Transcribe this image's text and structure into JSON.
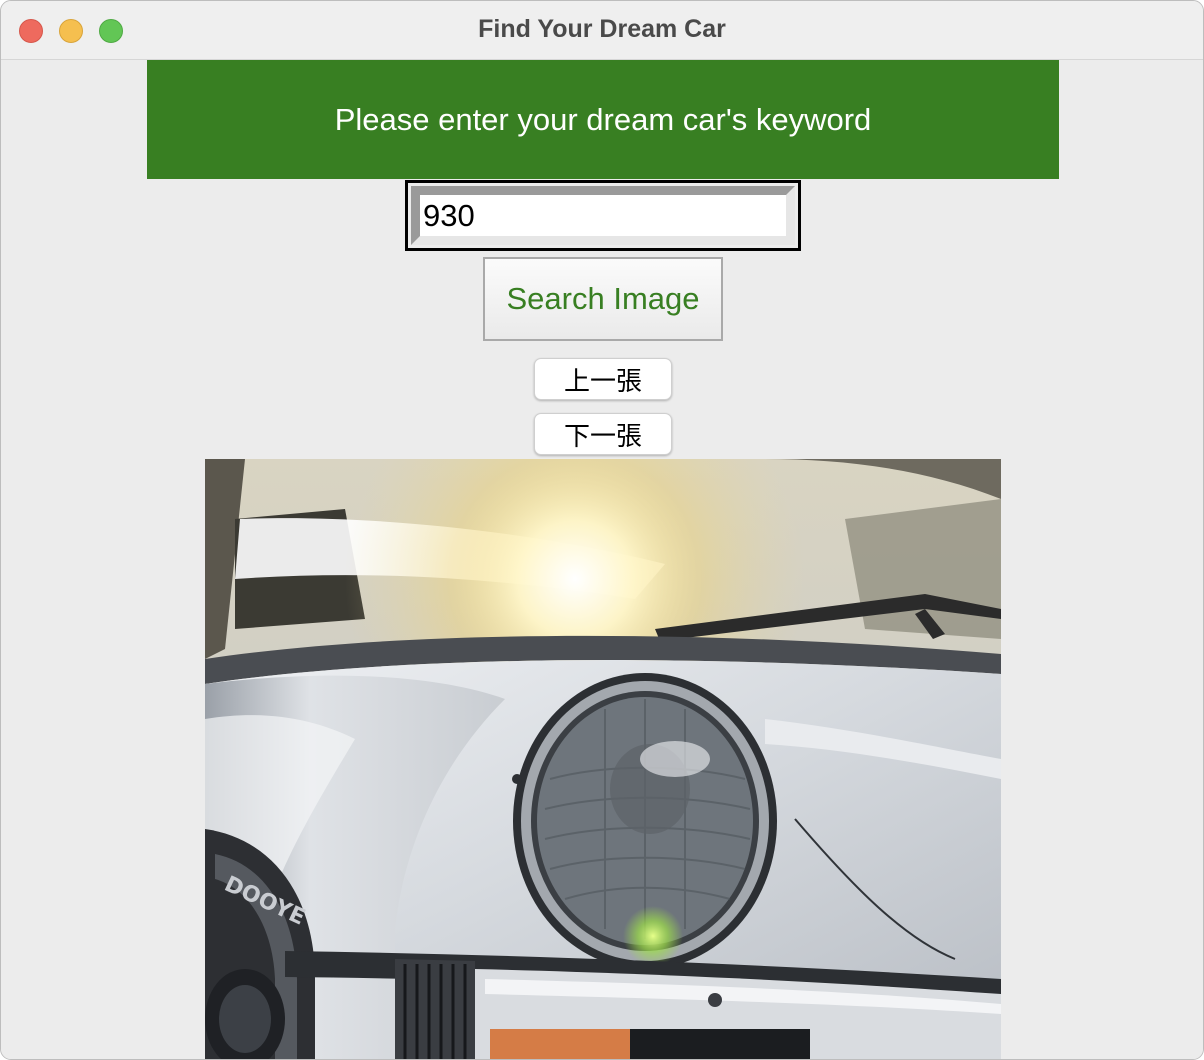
{
  "window": {
    "title": "Find Your Dream Car"
  },
  "banner": {
    "text": "Please enter your dream car's keyword"
  },
  "search": {
    "value": "930",
    "button_label": "Search Image"
  },
  "navigation": {
    "prev_label": "上一張",
    "next_label": "下一張"
  },
  "result_image": {
    "subject": "silver-car-front-headlight-photo"
  },
  "colors": {
    "banner_bg": "#387f22",
    "banner_text": "#ffffff",
    "search_button_text": "#387f22",
    "window_bg": "#ececec"
  }
}
